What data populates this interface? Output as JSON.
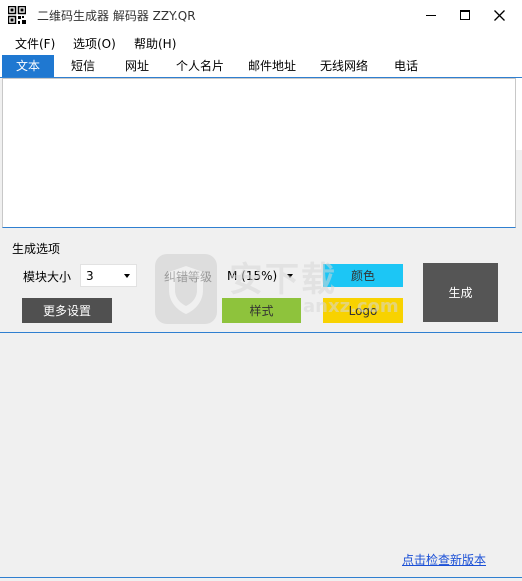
{
  "window": {
    "title": "二维码生成器 解码器 ZZY.QR"
  },
  "menu": {
    "file": "文件(F)",
    "options": "选项(O)",
    "help": "帮助(H)"
  },
  "tabs": [
    {
      "label": "文本",
      "active": true
    },
    {
      "label": "短信",
      "active": false
    },
    {
      "label": "网址",
      "active": false
    },
    {
      "label": "个人名片",
      "active": false
    },
    {
      "label": "邮件地址",
      "active": false
    },
    {
      "label": "无线网络",
      "active": false
    },
    {
      "label": "电话",
      "active": false
    }
  ],
  "text_input": {
    "value": ""
  },
  "options": {
    "group_label": "生成选项",
    "module_size_label": "模块大小",
    "module_size_value": "3",
    "error_level_label": "纠错等级",
    "error_level_value": "M (15%)",
    "more_settings": "更多设置",
    "color_button": "颜色",
    "style_button": "样式",
    "logo_button": "Logo",
    "generate_button": "生成"
  },
  "footer": {
    "update_link": "点击检查新版本"
  },
  "colors": {
    "tab_active": "#1f78d1",
    "color_button": "#1cc6f5",
    "style_button": "#8ec33c",
    "logo_button": "#f8d200",
    "dark_button": "#505050",
    "accent_line": "#2f7fd0",
    "link": "#1a4fd6"
  },
  "watermark": {
    "text": "安下载",
    "sub": "anxz.com",
    "icon": "shield-icon"
  }
}
